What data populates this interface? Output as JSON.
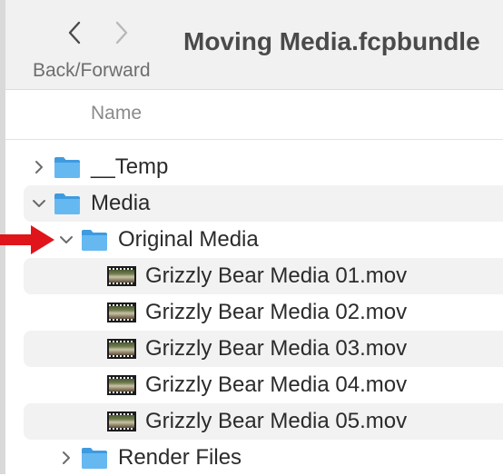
{
  "toolbar": {
    "nav_label": "Back/Forward",
    "title": "Moving Media.fcpbundle"
  },
  "columns": {
    "name": "Name"
  },
  "files": [
    {
      "label": "__Temp",
      "type": "folder",
      "expanded": false,
      "depth": 0
    },
    {
      "label": "Media",
      "type": "folder",
      "expanded": true,
      "depth": 0
    },
    {
      "label": "Original Media",
      "type": "folder",
      "expanded": true,
      "depth": 1
    },
    {
      "label": "Grizzly Bear Media 01.mov",
      "type": "movie",
      "depth": 2
    },
    {
      "label": "Grizzly Bear Media 02.mov",
      "type": "movie",
      "depth": 2
    },
    {
      "label": "Grizzly Bear Media 03.mov",
      "type": "movie",
      "depth": 2
    },
    {
      "label": "Grizzly Bear Media 04.mov",
      "type": "movie",
      "depth": 2
    },
    {
      "label": "Grizzly Bear Media 05.mov",
      "type": "movie",
      "depth": 2
    },
    {
      "label": "Render Files",
      "type": "folder",
      "expanded": false,
      "depth": 1
    }
  ],
  "colors": {
    "folder": "#5fb3ef",
    "arrow": "#e0141b",
    "chevron": "#6b6b6b"
  }
}
